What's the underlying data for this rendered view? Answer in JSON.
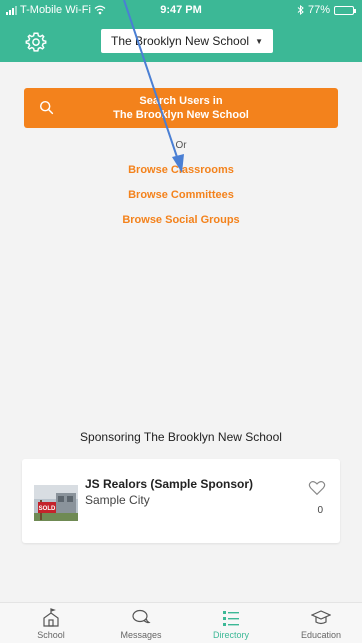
{
  "status_bar": {
    "carrier": "T-Mobile Wi-Fi",
    "time": "9:47 PM",
    "battery_pct": "77%"
  },
  "header": {
    "school_name": "The Brooklyn New School"
  },
  "search": {
    "line1": "Search Users in",
    "line2": "The Brooklyn New School"
  },
  "or_label": "Or",
  "browse_links": [
    "Browse Classrooms",
    "Browse Committees",
    "Browse Social Groups"
  ],
  "sponsor": {
    "heading": "Sponsoring The Brooklyn New School",
    "name": "JS Realors (Sample Sponsor)",
    "city": "Sample City",
    "likes": "0",
    "image_sign_text": "SOLD"
  },
  "tabs": [
    {
      "label": "School",
      "icon": "school-icon"
    },
    {
      "label": "Messages",
      "icon": "messages-icon"
    },
    {
      "label": "Directory",
      "icon": "directory-icon"
    },
    {
      "label": "Education",
      "icon": "education-icon"
    }
  ],
  "colors": {
    "brand": "#3cb896",
    "accent": "#f3821c",
    "annotation_arrow": "#4a7fd4"
  }
}
